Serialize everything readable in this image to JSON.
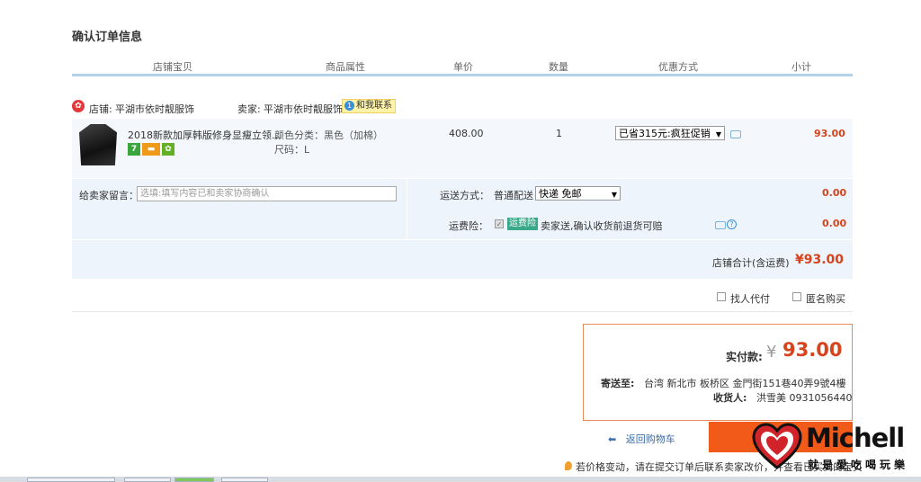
{
  "page": {
    "title": "确认订单信息"
  },
  "columns": [
    "店铺宝贝",
    "商品属性",
    "单价",
    "数量",
    "优惠方式",
    "小计"
  ],
  "shop": {
    "label": "店铺:",
    "name": "平湖市依时靓服饰",
    "seller_label": "卖家:",
    "seller_name": "平湖市依时靓服饰",
    "contact_label": "和我联系",
    "contact_badge": "1"
  },
  "item": {
    "name": "2018新款加厚韩版修身显瘦立领...",
    "attr_color": "颜色分类：黑色（加棉）",
    "attr_size": "尺码：L",
    "price": "408.00",
    "quantity": "1",
    "discount": "已省315元:疯狂促销",
    "subtotal": "93.00",
    "badge_seven": "7"
  },
  "message": {
    "label": "给卖家留言：",
    "placeholder": "选填:填写内容已和卖家协商确认"
  },
  "shipping": {
    "label": "运送方式：",
    "method": "普通配送",
    "option": "快递 免邮",
    "cost": "0.00"
  },
  "insurance": {
    "label": "运费险：",
    "badge": "运费险",
    "text": "卖家送,确认收货前退货可赔",
    "cost": "0.00"
  },
  "shop_total": {
    "label": "店铺合计(含运费)",
    "value": "¥93.00"
  },
  "options": {
    "agent_pay": "找人代付",
    "anonymous": "匿名购买"
  },
  "payment": {
    "label": "实付款:",
    "currency": "¥",
    "value": "93.00",
    "address_label": "寄送至:",
    "address": "台湾 新北市 板桥区    金門街151巷40弄9號4樓",
    "recipient_label": "收货人:",
    "recipient": "洪雪美  0931056440"
  },
  "back_link": "返回购物车",
  "notice": "若价格变动，请在提交订单后联系卖家改价，并查看已买到的宝贝",
  "watermark": {
    "brand": "Michell",
    "tagline": "就是愛吃喝玩樂"
  },
  "colors": {
    "accent": "#f25a1a",
    "price_red": "#d6431c",
    "head_line": "#b2d1ea",
    "panel": "#eef4fb"
  }
}
